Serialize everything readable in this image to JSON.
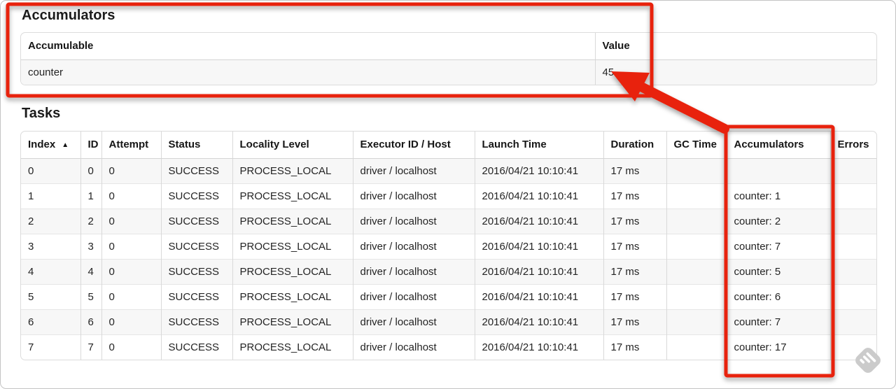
{
  "colors": {
    "annotation_red": "#e8220d",
    "row_stripe": "#f7f7f7"
  },
  "accumulators_section": {
    "title": "Accumulators",
    "table": {
      "col_accumulable": "Accumulable",
      "col_value": "Value",
      "rows": [
        [
          "counter",
          "45"
        ]
      ]
    }
  },
  "tasks_section": {
    "title": "Tasks",
    "table": {
      "headers": [
        "Index",
        "ID",
        "Attempt",
        "Status",
        "Locality Level",
        "Executor ID / Host",
        "Launch Time",
        "Duration",
        "GC Time",
        "Accumulators",
        "Errors"
      ],
      "sort_indicator": "▲",
      "rows": [
        [
          "0",
          "0",
          "0",
          "SUCCESS",
          "PROCESS_LOCAL",
          "driver / localhost",
          "2016/04/21 10:10:41",
          "17 ms",
          "",
          "",
          ""
        ],
        [
          "1",
          "1",
          "0",
          "SUCCESS",
          "PROCESS_LOCAL",
          "driver / localhost",
          "2016/04/21 10:10:41",
          "17 ms",
          "",
          "counter: 1",
          ""
        ],
        [
          "2",
          "2",
          "0",
          "SUCCESS",
          "PROCESS_LOCAL",
          "driver / localhost",
          "2016/04/21 10:10:41",
          "17 ms",
          "",
          "counter: 2",
          ""
        ],
        [
          "3",
          "3",
          "0",
          "SUCCESS",
          "PROCESS_LOCAL",
          "driver / localhost",
          "2016/04/21 10:10:41",
          "17 ms",
          "",
          "counter: 7",
          ""
        ],
        [
          "4",
          "4",
          "0",
          "SUCCESS",
          "PROCESS_LOCAL",
          "driver / localhost",
          "2016/04/21 10:10:41",
          "17 ms",
          "",
          "counter: 5",
          ""
        ],
        [
          "5",
          "5",
          "0",
          "SUCCESS",
          "PROCESS_LOCAL",
          "driver / localhost",
          "2016/04/21 10:10:41",
          "17 ms",
          "",
          "counter: 6",
          ""
        ],
        [
          "6",
          "6",
          "0",
          "SUCCESS",
          "PROCESS_LOCAL",
          "driver / localhost",
          "2016/04/21 10:10:41",
          "17 ms",
          "",
          "counter: 7",
          ""
        ],
        [
          "7",
          "7",
          "0",
          "SUCCESS",
          "PROCESS_LOCAL",
          "driver / localhost",
          "2016/04/21 10:10:41",
          "17 ms",
          "",
          "counter: 17",
          ""
        ]
      ]
    }
  }
}
